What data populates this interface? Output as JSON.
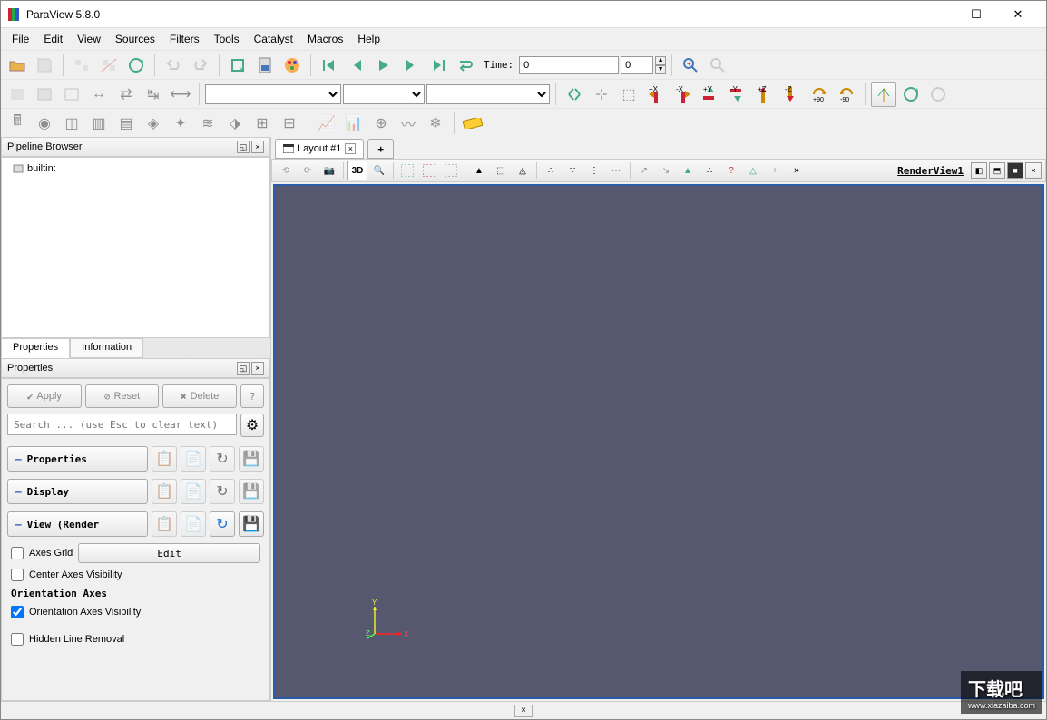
{
  "app": {
    "title": "ParaView 5.8.0"
  },
  "menu": [
    "File",
    "Edit",
    "View",
    "Sources",
    "Filters",
    "Tools",
    "Catalyst",
    "Macros",
    "Help"
  ],
  "time": {
    "label": "Time:",
    "value": "0",
    "step": "0"
  },
  "pipeline": {
    "title": "Pipeline Browser",
    "root": "builtin:"
  },
  "propTabs": [
    "Properties",
    "Information"
  ],
  "properties": {
    "title": "Properties",
    "apply": "Apply",
    "reset": "Reset",
    "delete": "Delete",
    "searchPlaceholder": "Search ... (use Esc to clear text)",
    "sections": {
      "props": "Properties",
      "display": "Display",
      "view": "View (Render"
    },
    "axesGrid": "Axes Grid",
    "editBtn": "Edit",
    "centerAxes": "Center Axes Visibility",
    "orientHeading": "Orientation Axes",
    "orientVis": "Orientation Axes Visibility",
    "hiddenLine": "Hidden Line Removal"
  },
  "layout": {
    "tab": "Layout #1",
    "view": "RenderView1",
    "mode3d": "3D"
  },
  "axes": {
    "x": "X",
    "y": "Y",
    "z": "Z"
  },
  "watermark": {
    "main": "下载吧",
    "sub": "www.xiazaiba.com"
  }
}
